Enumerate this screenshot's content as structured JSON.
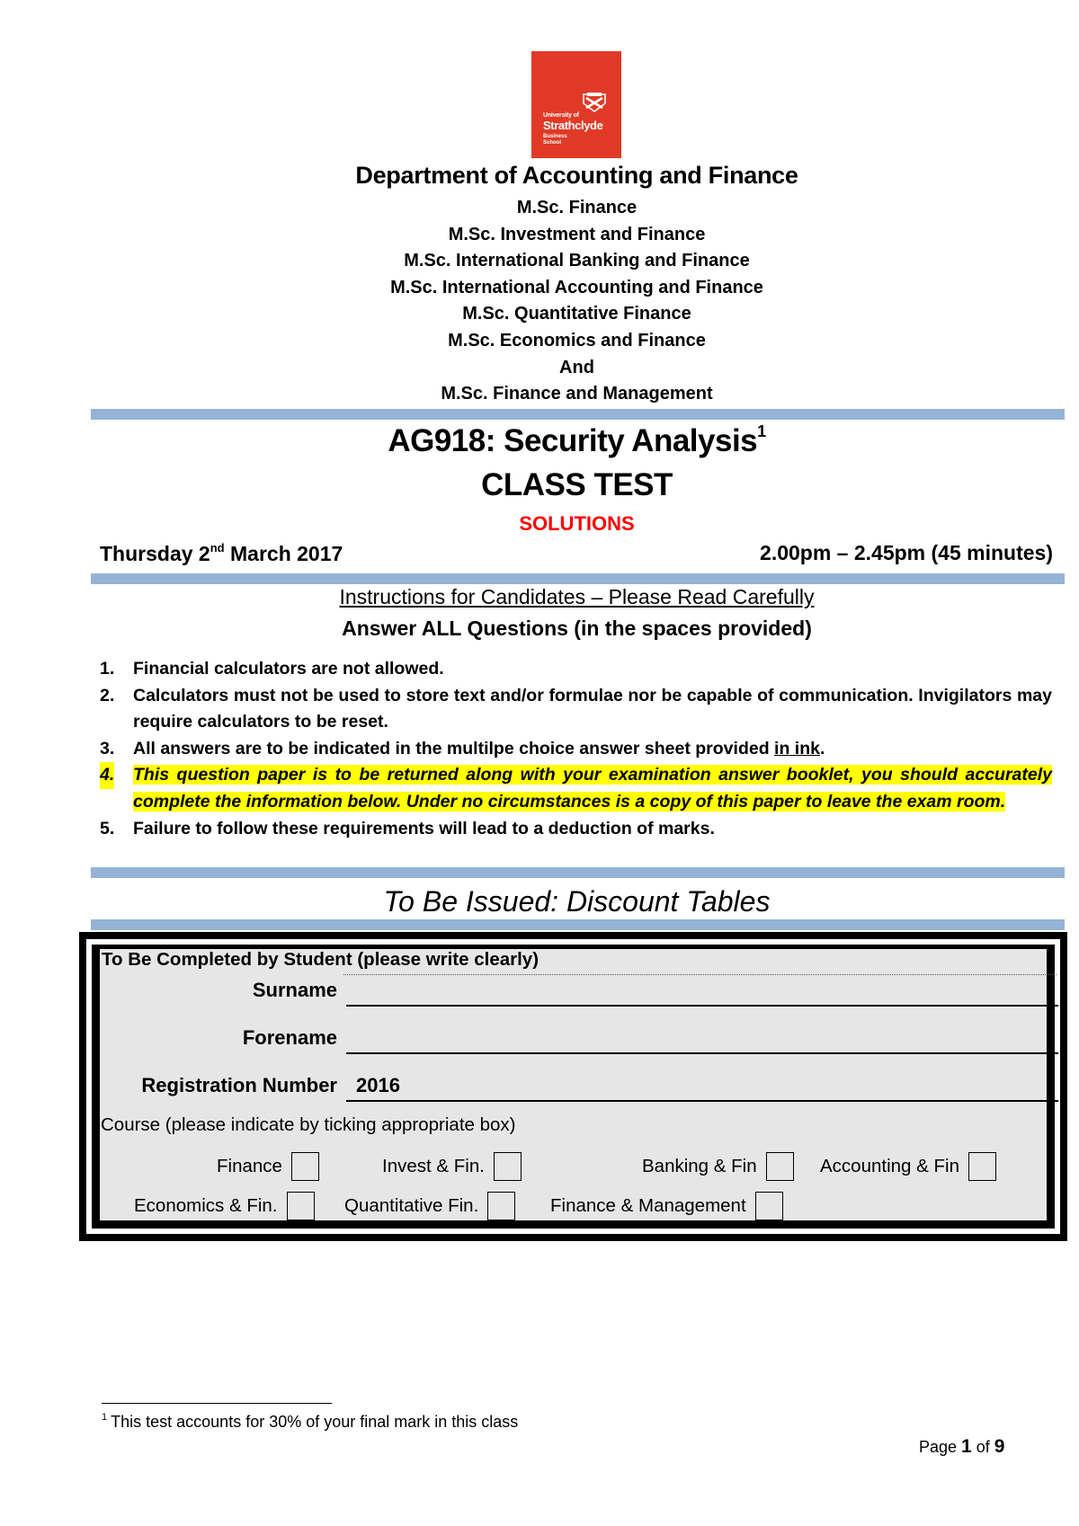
{
  "logo": {
    "line1": "University of",
    "line2": "Strathclyde",
    "line3": "Business",
    "line4": "School",
    "color": "#e03a26"
  },
  "header": {
    "department": "Department of Accounting and Finance",
    "programmes": [
      "M.Sc. Finance",
      "M.Sc. Investment and Finance",
      "M.Sc. International Banking and Finance",
      "M.Sc. International Accounting and Finance",
      "M.Sc. Quantitative Finance",
      "M.Sc. Economics and Finance",
      "And",
      "M.Sc. Finance and Management"
    ]
  },
  "title": {
    "course": "AG918: Security Analysis",
    "footnote_ref": "1",
    "subtitle": "CLASS TEST",
    "solutions": "SOLUTIONS",
    "solutions_color": "#ff0000"
  },
  "schedule": {
    "day": "Thursday 2",
    "day_suffix": "nd",
    "month_year": " March 2017",
    "time": "2.00pm – 2.45pm (45 minutes)"
  },
  "instructions": {
    "heading": "Instructions for Candidates – Please Read Carefully",
    "answer_all": "Answer ALL Questions (in the spaces provided)",
    "items": [
      {
        "num": "1.",
        "text": "Financial calculators are not allowed."
      },
      {
        "num": "2.",
        "text": "Calculators must not be used to store text and/or formulae nor be  capable of communication. Invigilators may require calculators to be reset."
      },
      {
        "num": "3.",
        "text": "All answers are to be indicated in the multilpe choice answer sheet provided ",
        "underlined": "in ink",
        "after": "."
      },
      {
        "num": "4.",
        "text": "This question paper is to be returned along with your examination answer booklet, you should accurately complete the information below.  Under no circumstances is a copy of this paper to leave the exam room.",
        "highlighted": true
      },
      {
        "num": "5.",
        "text": "Failure to follow these requirements will lead to a deduction of marks."
      }
    ]
  },
  "issued": "To Be Issued: Discount Tables",
  "form": {
    "title": "To Be Completed by Student (please write clearly)",
    "fields": [
      {
        "label": "Surname",
        "value": ""
      },
      {
        "label": "Forename",
        "value": ""
      },
      {
        "label": "Registration Number",
        "value": "2016"
      }
    ],
    "course_prompt": "Course (please indicate by ticking appropriate box)",
    "options": [
      {
        "label": "Finance",
        "checked": false
      },
      {
        "label": "Invest & Fin.",
        "checked": false
      },
      {
        "label": "Banking & Fin",
        "checked": false
      },
      {
        "label": "Accounting & Fin",
        "checked": false
      },
      {
        "label": "Economics & Fin.",
        "checked": false
      },
      {
        "label": "Quantitative Fin.",
        "checked": false
      },
      {
        "label": "Finance & Management",
        "checked": false
      }
    ]
  },
  "footnote": {
    "ref": "1",
    "text": "This test accounts for 30% of your final mark in this class"
  },
  "page": {
    "prefix": "Page ",
    "current": "1",
    "of": " of ",
    "total": "9"
  },
  "colors": {
    "rule": "#95b3d7",
    "highlight": "#ffff00",
    "form_bg": "#e6e6e6"
  }
}
